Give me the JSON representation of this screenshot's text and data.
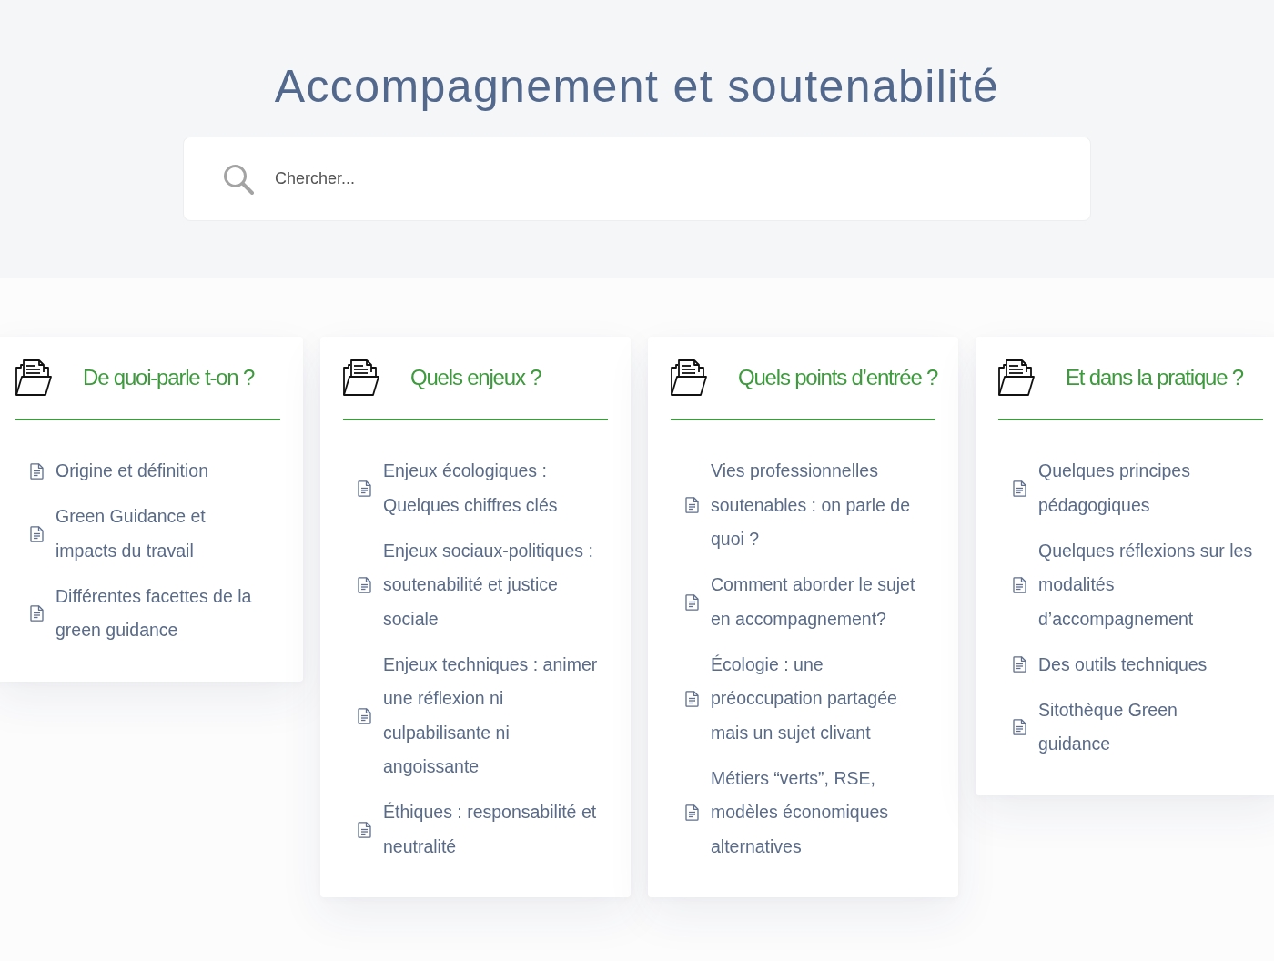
{
  "title": "Accompagnement et soutenabilité",
  "search": {
    "placeholder": "Chercher..."
  },
  "sections": [
    {
      "heading": "De quoi-parle t-on ?",
      "items": [
        "Origine et définition",
        "Green Guidance et impacts du travail",
        "Différentes facettes de la green guidance"
      ]
    },
    {
      "heading": "Quels enjeux ?",
      "items": [
        "Enjeux écologiques : Quelques chiffres clés",
        "Enjeux sociaux-politiques : soutenabilité et justice sociale",
        "Enjeux techniques : animer une réflexion ni culpabilisante ni angoissante",
        "Éthiques : responsabilité et neutralité"
      ]
    },
    {
      "heading": "Quels points d’entrée ?",
      "items": [
        "Vies professionnelles soutenables : on parle de quoi ?",
        "Comment aborder le sujet en accompagnement?",
        "Écologie : une préoccupation partagée mais un sujet clivant",
        "Métiers “verts”, RSE, modèles économiques alternatives"
      ]
    },
    {
      "heading": "Et dans la pratique ?",
      "items": [
        "Quelques principes pédagogiques",
        "Quelques réflexions sur les modalités d’accompagnement",
        "Des outils techniques",
        "Sitothèque Green guidance"
      ]
    }
  ]
}
